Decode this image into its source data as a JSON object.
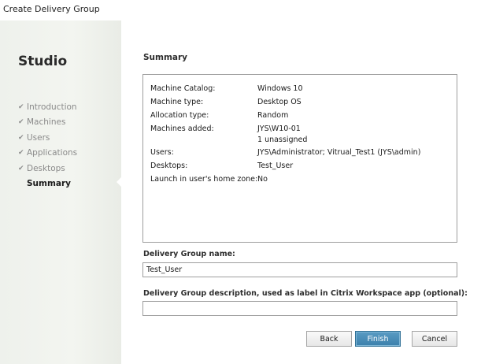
{
  "window": {
    "title": "Create Delivery Group"
  },
  "sidebar": {
    "app_name": "Studio",
    "steps": [
      {
        "label": "Introduction",
        "done": true
      },
      {
        "label": "Machines",
        "done": true
      },
      {
        "label": "Users",
        "done": true
      },
      {
        "label": "Applications",
        "done": true
      },
      {
        "label": "Desktops",
        "done": true
      },
      {
        "label": "Summary",
        "done": false,
        "current": true
      }
    ],
    "check_glyph": "✔"
  },
  "main": {
    "heading": "Summary",
    "summary": [
      {
        "key": "Machine Catalog:",
        "value": "Windows 10"
      },
      {
        "key": "Machine type:",
        "value": "Desktop OS"
      },
      {
        "key": "Allocation type:",
        "value": "Random"
      },
      {
        "key": "Machines added:",
        "value": "JYS\\W10-01",
        "value2": "1 unassigned"
      },
      {
        "key": "Users:",
        "value": "JYS\\Administrator; Vitrual_Test1 (JYS\\admin)"
      },
      {
        "key": "Desktops:",
        "value": "Test_User"
      },
      {
        "key": "Launch in user's home zone:",
        "value": "No"
      }
    ],
    "group_name_label": "Delivery Group name:",
    "group_name_value": "Test_User",
    "description_label": "Delivery Group description, used as label in Citrix Workspace app (optional):",
    "description_value": ""
  },
  "buttons": {
    "back": "Back",
    "finish": "Finish",
    "cancel": "Cancel"
  },
  "colors": {
    "primary_button": "#3b7fab",
    "sidebar_bg": "#eef1ec"
  }
}
